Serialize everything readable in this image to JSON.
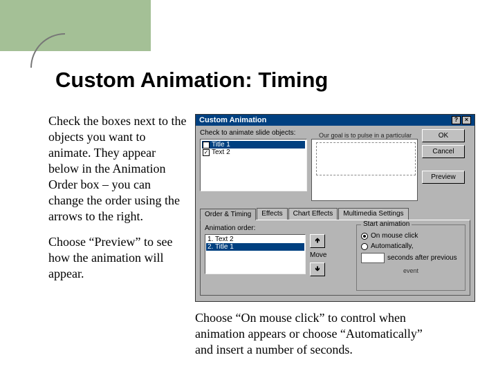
{
  "slide": {
    "title": "Custom Animation: Timing",
    "para1": "Check the boxes next to the objects you want to animate. They appear below in the Animation Order box – you can change the order using the arrows to the right.",
    "para2": "Choose “Preview” to see how the animation will appear.",
    "para3": "Choose “On mouse click” to control when animation appears or choose “Automatically” and insert a number of seconds."
  },
  "dialog": {
    "title": "Custom Animation",
    "help_btn": "?",
    "close_btn": "×",
    "objects_label": "Check to animate slide objects:",
    "objects": [
      {
        "label": "Title 1",
        "checked": true,
        "selected": true
      },
      {
        "label": "Text 2",
        "checked": true,
        "selected": false
      }
    ],
    "preview_note": "Our goal is to pulse in a particular idea.",
    "buttons": {
      "ok": "OK",
      "cancel": "Cancel",
      "preview": "Preview"
    },
    "tabs": [
      "Order & Timing",
      "Effects",
      "Chart Effects",
      "Multimedia Settings"
    ],
    "active_tab": 0,
    "order_label": "Animation order:",
    "order": [
      {
        "label": "1. Text 2",
        "selected": false
      },
      {
        "label": "2. Title 1",
        "selected": true
      }
    ],
    "move_label": "Move",
    "start_group": "Start animation",
    "radio_mouse": "On mouse click",
    "radio_auto": "Automatically,",
    "seconds_suffix": "seconds after previous",
    "level_text": "event"
  }
}
